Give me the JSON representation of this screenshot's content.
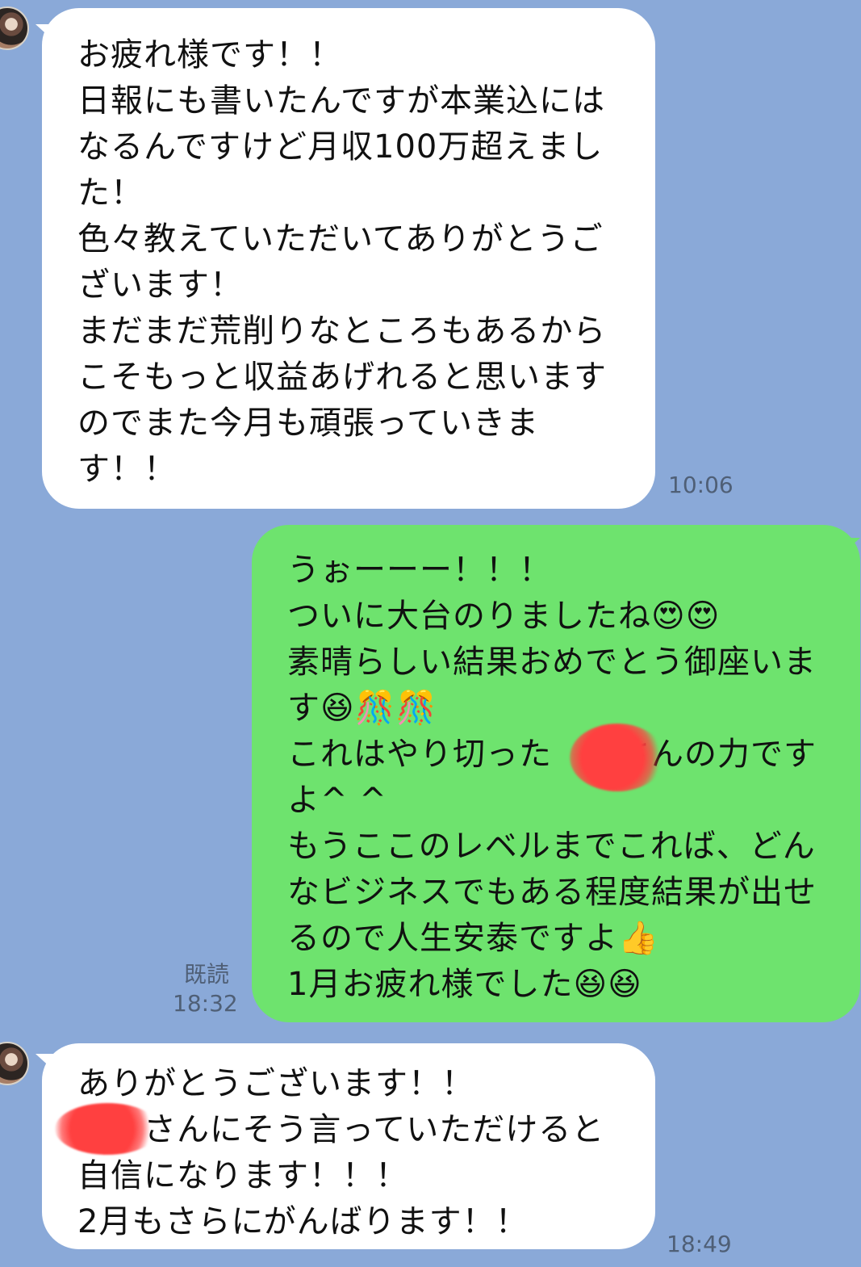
{
  "messages": [
    {
      "sender": "other",
      "text": "お疲れ様です！！\n日報にも書いたんですが本業込にはなるんですけど月収100万超えました！\n色々教えていただいてありがとうございます！\nまだまだ荒削りなところもあるからこそもっと収益あげれると思いますのでまた今月も頑張っていきます！！",
      "time": "10:06"
    },
    {
      "sender": "me",
      "text": "うぉーーー！！！\nついに大台のりましたね😍😍\n素晴らしい結果おめでとう御座います😆🎊🎊\nこれはやり切った　　さんの力ですよ^ ^\nもうここのレベルまでこれば、どんなビジネスでもある程度結果が出せるので人生安泰ですよ👍\n1月お疲れ様でした😆😆",
      "read": "既読",
      "time": "18:32"
    },
    {
      "sender": "other",
      "text": "ありがとうございます！！\n　　さんにそう言っていただけると自信になります！！！\n2月もさらにがんばります！！",
      "time": "18:49"
    }
  ],
  "colors": {
    "background": "#8aa9d8",
    "incoming_bubble": "#ffffff",
    "outgoing_bubble": "#6ee36e",
    "timestamp": "#4f5f76",
    "redaction": "#ff4040"
  },
  "icons": {
    "avatar": "avatar-icon"
  }
}
